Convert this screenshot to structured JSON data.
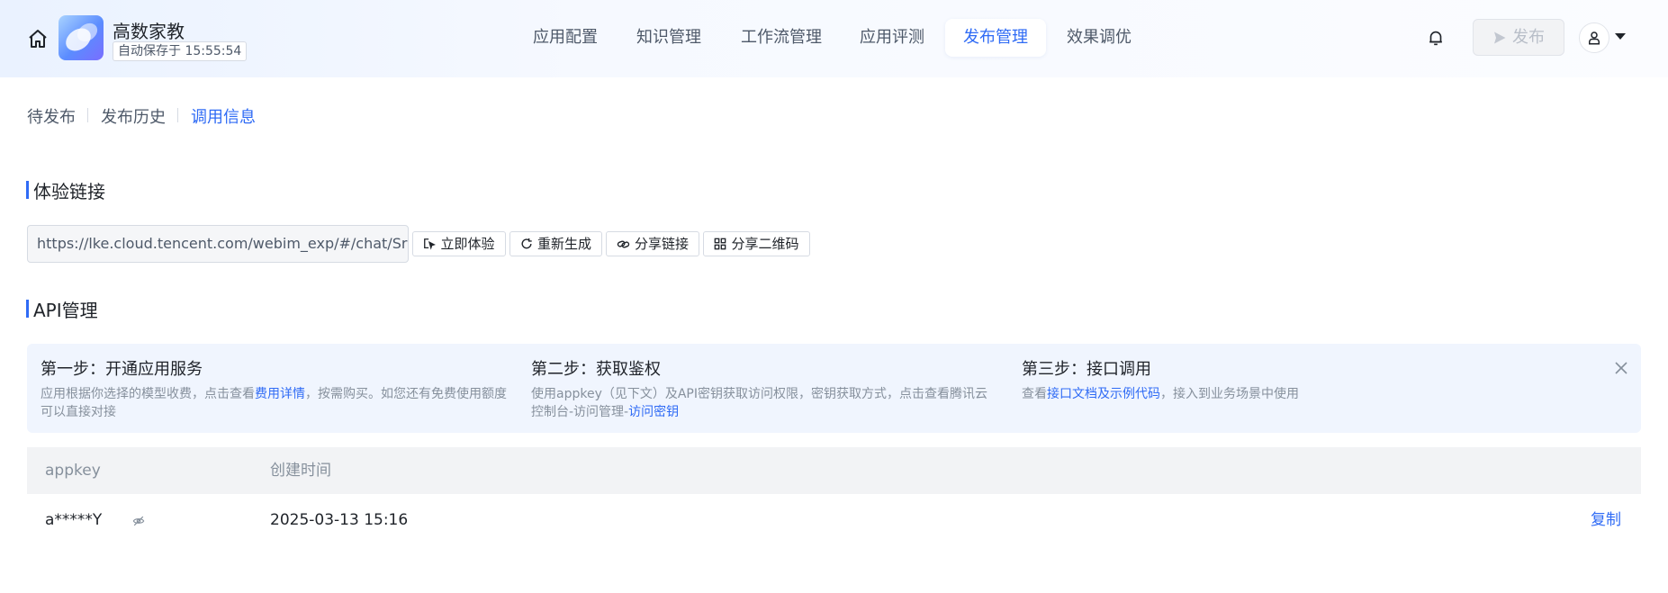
{
  "header": {
    "app_name": "高数家教",
    "autosave": "自动保存于 15:55:54",
    "publish_label": "发布"
  },
  "nav": {
    "tabs": [
      {
        "label": "应用配置"
      },
      {
        "label": "知识管理"
      },
      {
        "label": "工作流管理"
      },
      {
        "label": "应用评测"
      },
      {
        "label": "发布管理",
        "active": true
      },
      {
        "label": "效果调优"
      }
    ]
  },
  "subtabs": [
    {
      "label": "待发布"
    },
    {
      "label": "发布历史"
    },
    {
      "label": "调用信息",
      "active": true
    }
  ],
  "experience": {
    "title": "体验链接",
    "url": "https://lke.cloud.tencent.com/webim_exp/#/chat/SrlCoa",
    "buttons": {
      "try": "立即体验",
      "regenerate": "重新生成",
      "share_link": "分享链接",
      "share_qr": "分享二维码"
    }
  },
  "api": {
    "title": "API管理",
    "steps": [
      {
        "title": "第一步：开通应用服务",
        "desc_before": "应用根据你选择的模型收费，点击查看",
        "link": "费用详情",
        "desc_after": "，按需购买。如您还有免费使用额度可以直接对接"
      },
      {
        "title": "第二步：获取鉴权",
        "desc_before": "使用appkey（见下文）及API密钥获取访问权限，密钥获取方式，点击查看腾讯云控制台-访问管理-",
        "link": "访问密钥",
        "desc_after": ""
      },
      {
        "title": "第三步：接口调用",
        "desc_before": "查看",
        "link": "接口文档及示例代码",
        "desc_after": "，接入到业务场景中使用"
      }
    ],
    "table": {
      "columns": [
        "appkey",
        "创建时间"
      ],
      "rows": [
        {
          "appkey": "a*****Y",
          "created": "2025-03-13 15:16",
          "action": "复制"
        }
      ]
    }
  },
  "colors": {
    "accent": "#2f6bf5",
    "panel_bg": "#f0f5fe",
    "header_bg": "#f2f3f5"
  },
  "icons": [
    "home-icon",
    "bell-icon",
    "send-icon",
    "user-icon",
    "cursor-click-icon",
    "refresh-icon",
    "link-icon",
    "qr-code-icon",
    "close-icon",
    "eye-off-icon"
  ]
}
